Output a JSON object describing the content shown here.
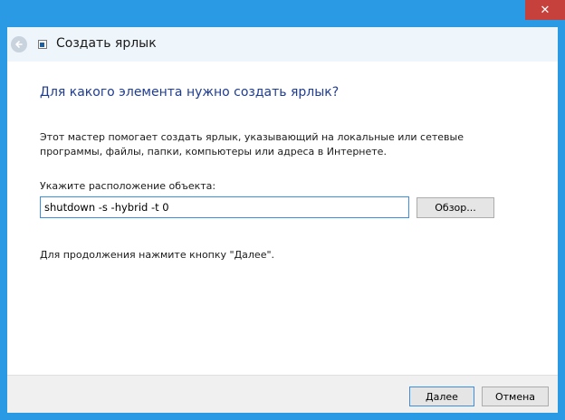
{
  "window": {
    "title": "Создать ярлык",
    "close_glyph": "✕",
    "back_icon": "back-arrow-icon",
    "title_icon": "shortcut-icon"
  },
  "main": {
    "heading": "Для какого элемента нужно создать ярлык?",
    "description": "Этот мастер помогает создать ярлык, указывающий на локальные или сетевые программы, файлы, папки, компьютеры или адреса в Интернете.",
    "location_label": "Укажите расположение объекта:",
    "location_value": "shutdown -s -hybrid -t 0",
    "browse_label": "Обзор...",
    "continue_text": "Для продолжения нажмите кнопку \"Далее\"."
  },
  "footer": {
    "next_label": "Далее",
    "cancel_label": "Отмена"
  },
  "colors": {
    "frame": "#2b9ae4",
    "heading": "#1f3c8f",
    "close": "#c7413c",
    "focus_border": "#3d8ee3"
  }
}
